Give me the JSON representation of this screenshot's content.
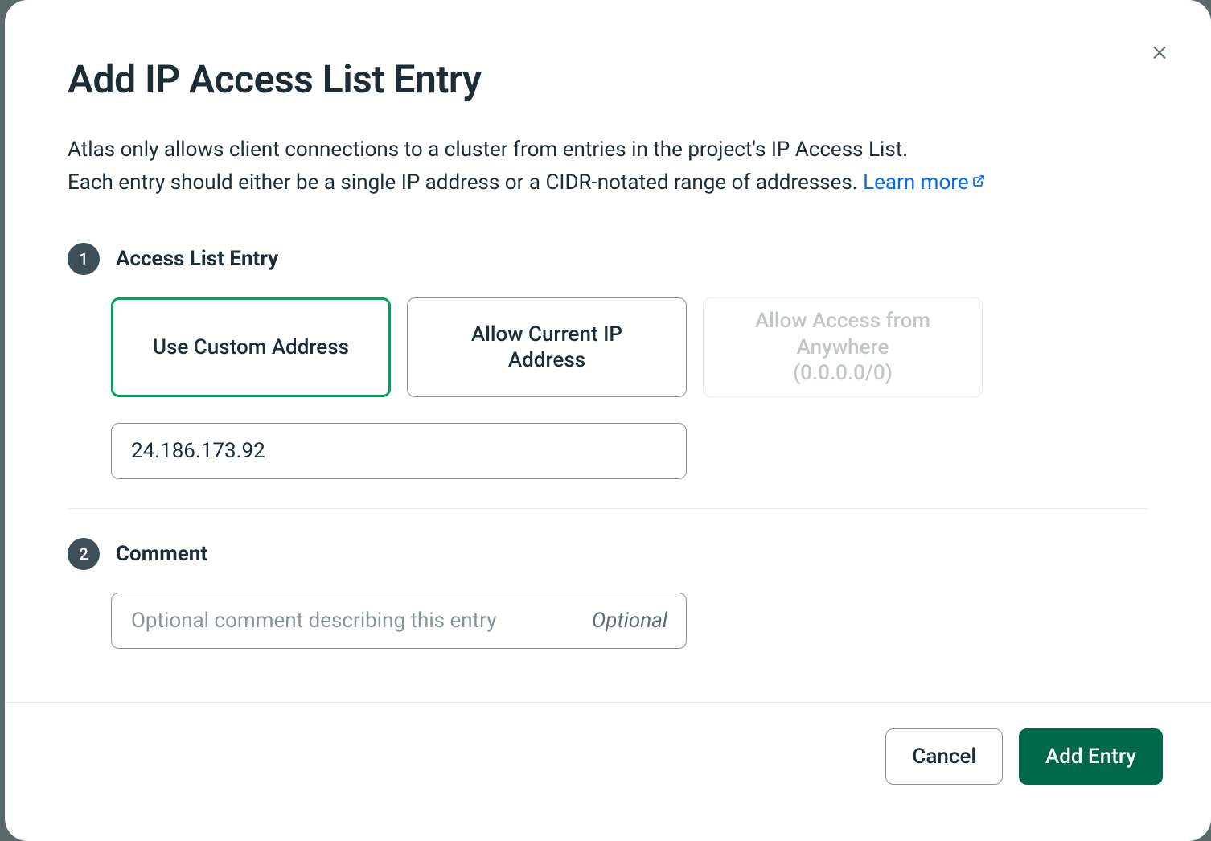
{
  "modal": {
    "title": "Add IP Access List Entry",
    "description_line1": "Atlas only allows client connections to a cluster from entries in the project's IP Access List.",
    "description_line2_prefix": "Each entry should either be a single IP address or a CIDR-notated range of addresses. ",
    "learn_more_label": "Learn more"
  },
  "steps": {
    "s1": {
      "number": "1",
      "title": "Access List Entry"
    },
    "s2": {
      "number": "2",
      "title": "Comment"
    }
  },
  "options": {
    "custom": "Use Custom Address",
    "current": "Allow Current IP Address",
    "anywhere_l1": "Allow Access from Anywhere",
    "anywhere_l2": "(0.0.0.0/0)"
  },
  "ip_input": {
    "value": "24.186.173.92"
  },
  "comment_input": {
    "placeholder": "Optional comment describing this entry",
    "suffix": "Optional",
    "value": ""
  },
  "footer": {
    "cancel": "Cancel",
    "submit": "Add Entry"
  }
}
